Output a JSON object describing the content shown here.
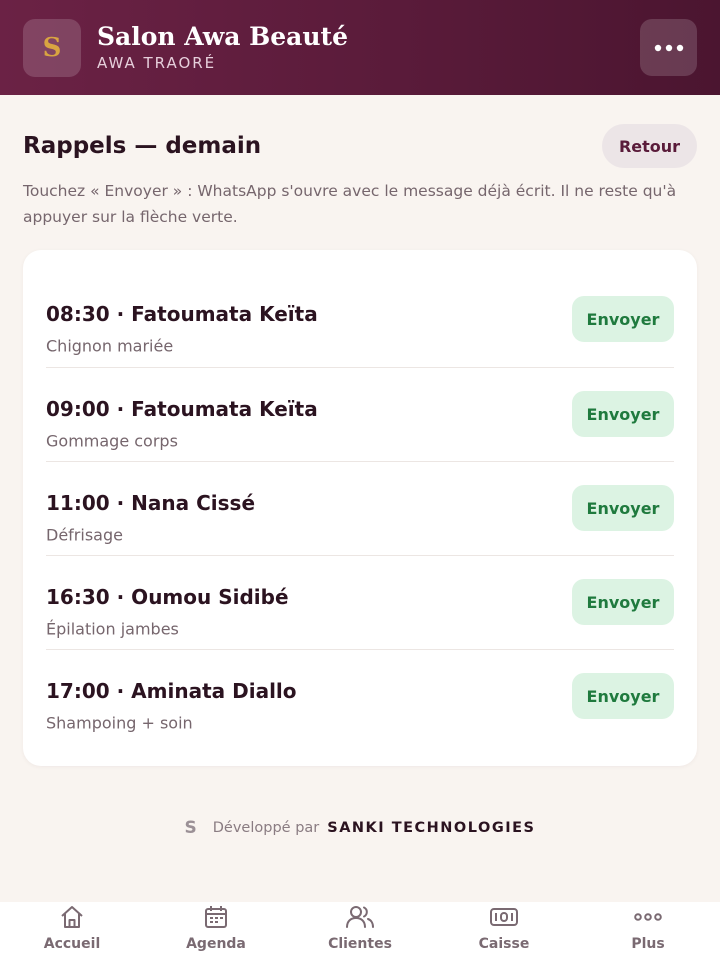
{
  "header": {
    "logo_letter": "S",
    "salon_name": "Salon Awa Beauté",
    "owner_name": "AWA TRAORÉ",
    "menu_icon": "more-icon"
  },
  "main": {
    "title": "Rappels — demain",
    "back_label": "Retour",
    "hint": "Touchez « Envoyer » : WhatsApp s'ouvre avec le message déjà écrit. Il ne reste qu'à appuyer sur la flèche verte."
  },
  "reminders": [
    {
      "time": "08:30",
      "client": "Fatoumata Keïta",
      "title": "08:30 · Fatoumata Keïta",
      "service": "Chignon mariée",
      "action": "Envoyer"
    },
    {
      "time": "09:00",
      "client": "Fatoumata Keïta",
      "title": "09:00 · Fatoumata Keïta",
      "service": "Gommage corps",
      "action": "Envoyer"
    },
    {
      "time": "11:00",
      "client": "Nana Cissé",
      "title": "11:00 · Nana Cissé",
      "service": "Défrisage",
      "action": "Envoyer"
    },
    {
      "time": "16:30",
      "client": "Oumou Sidibé",
      "title": "16:30 · Oumou Sidibé",
      "service": "Épilation jambes",
      "action": "Envoyer"
    },
    {
      "time": "17:00",
      "client": "Aminata Diallo",
      "title": "17:00 · Aminata Diallo",
      "service": "Shampoing + soin",
      "action": "Envoyer"
    }
  ],
  "footer": {
    "brand_letter": "S",
    "developed_by": "Développé par",
    "company": "SANKI TECHNOLOGIES"
  },
  "nav": [
    {
      "label": "Accueil",
      "icon": "home-icon"
    },
    {
      "label": "Agenda",
      "icon": "calendar-icon"
    },
    {
      "label": "Clientes",
      "icon": "users-icon"
    },
    {
      "label": "Caisse",
      "icon": "cash-icon"
    },
    {
      "label": "Plus",
      "icon": "more-icon"
    }
  ],
  "colors": {
    "header": "#5a1b3a",
    "accent_gold": "#d9a441",
    "background": "#f9f4f0",
    "send_bg": "#dcf3e3",
    "send_text": "#1f7a3e"
  }
}
